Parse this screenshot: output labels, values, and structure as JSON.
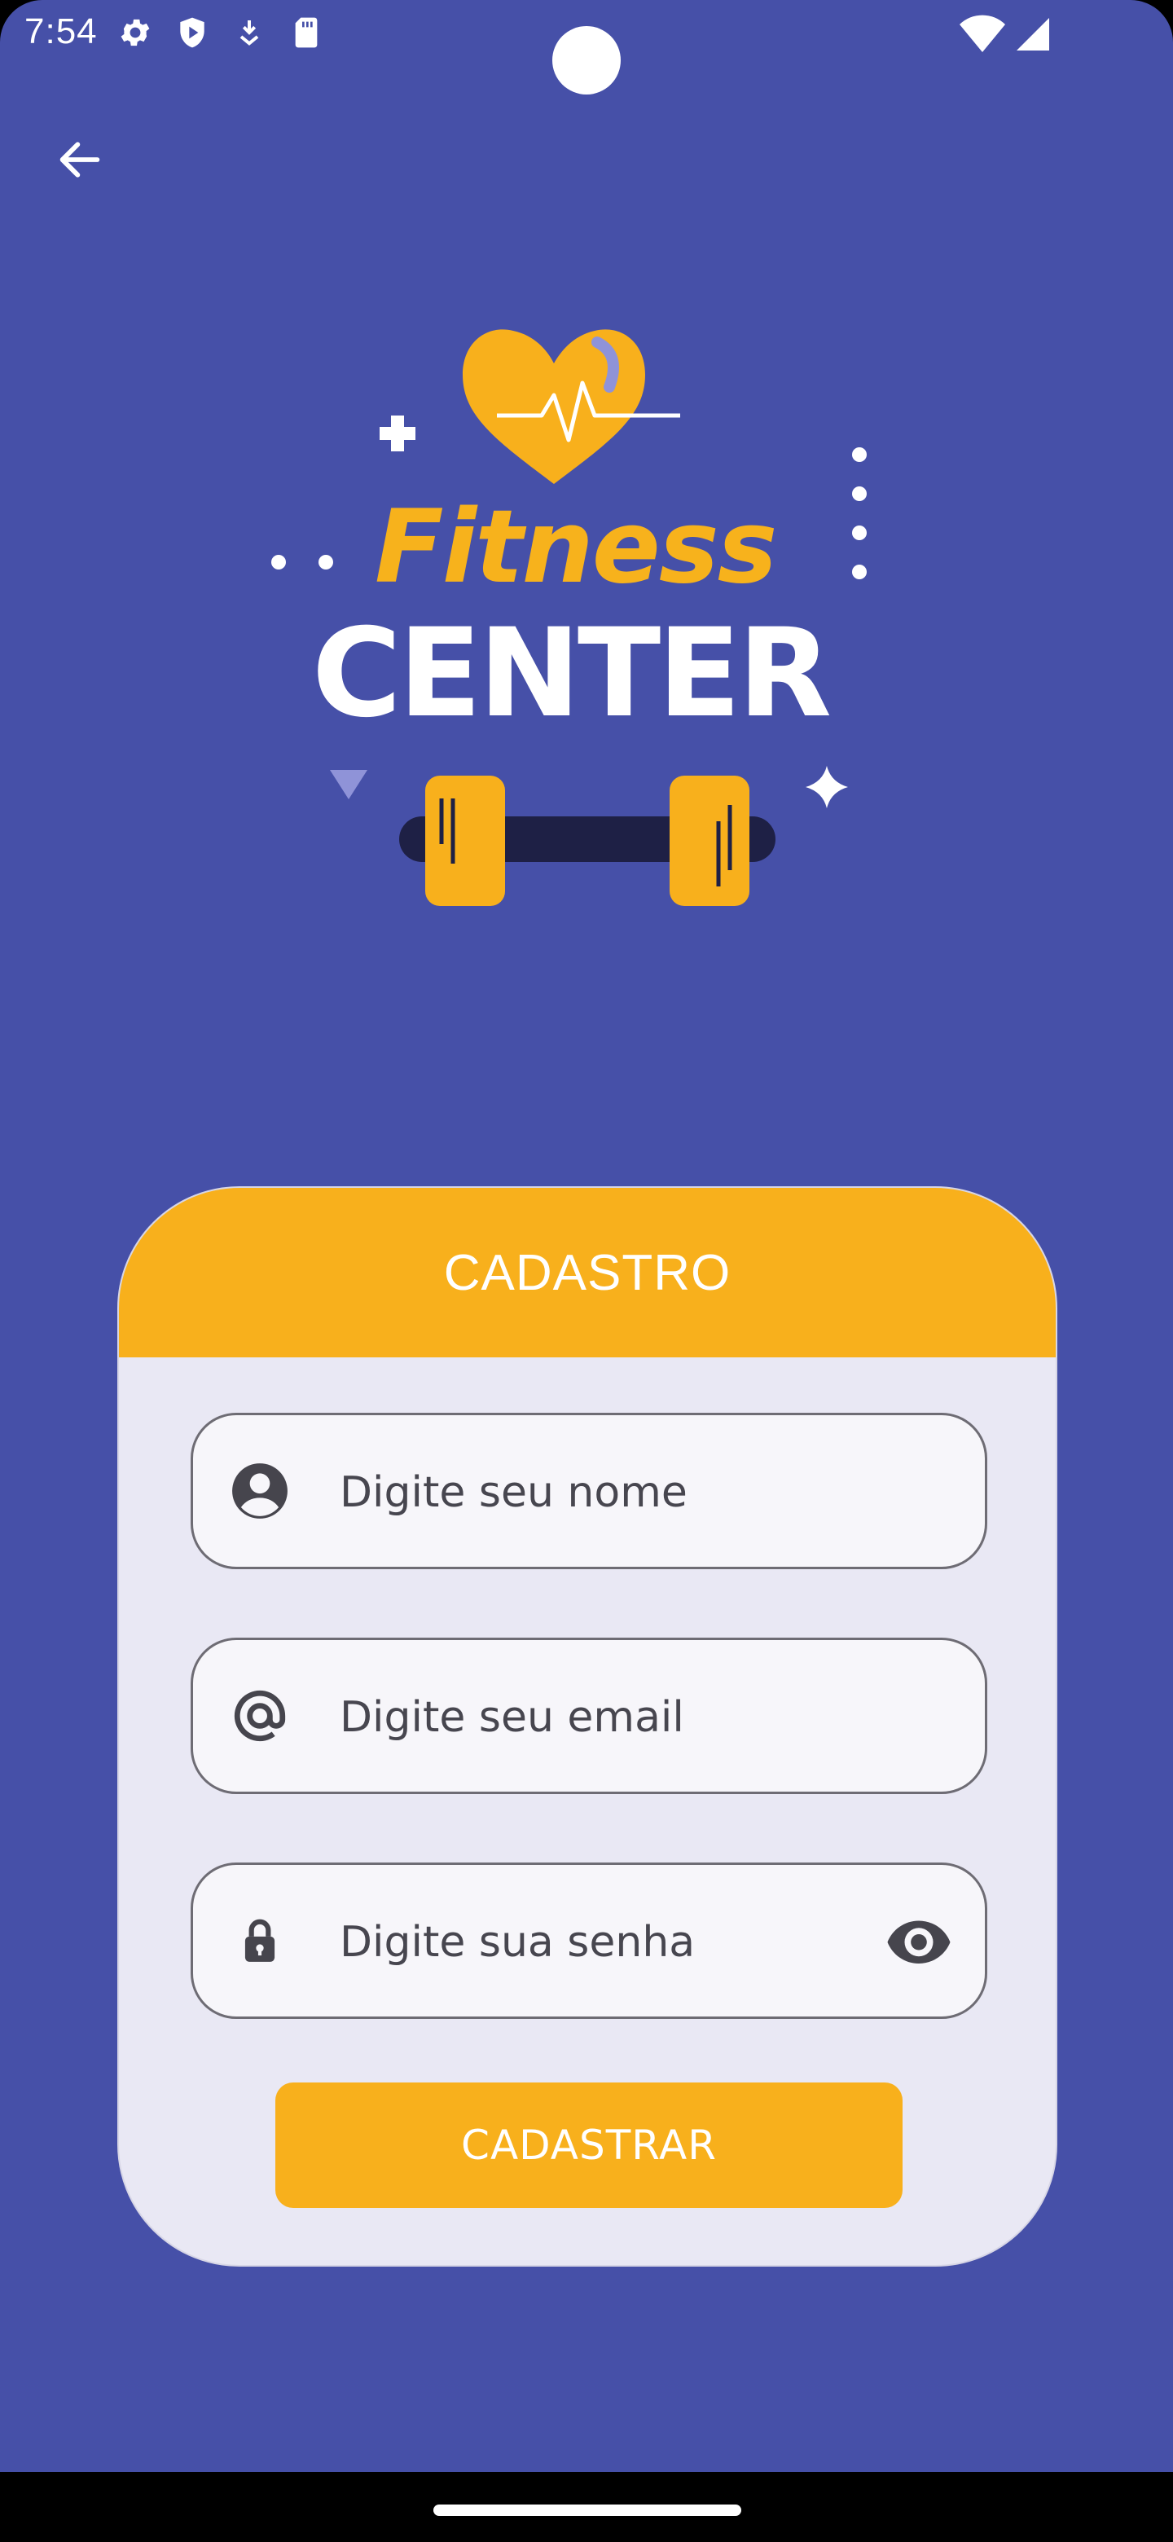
{
  "status_bar": {
    "time": "7:54",
    "left_icons": [
      "gear-icon",
      "play-protect-icon",
      "download-icon",
      "sd-card-icon"
    ],
    "right_icons": [
      "wifi-icon",
      "cell-signal-icon"
    ]
  },
  "logo": {
    "line1": "Fitness",
    "line2": "CENTER"
  },
  "form": {
    "title": "CADASTRO",
    "name_placeholder": "Digite seu nome",
    "email_placeholder": "Digite seu email",
    "password_placeholder": "Digite sua senha",
    "submit_label": "CADASTRAR"
  },
  "colors": {
    "background": "#4650A8",
    "accent": "#F8B01C",
    "card": "#E9E8F4"
  }
}
